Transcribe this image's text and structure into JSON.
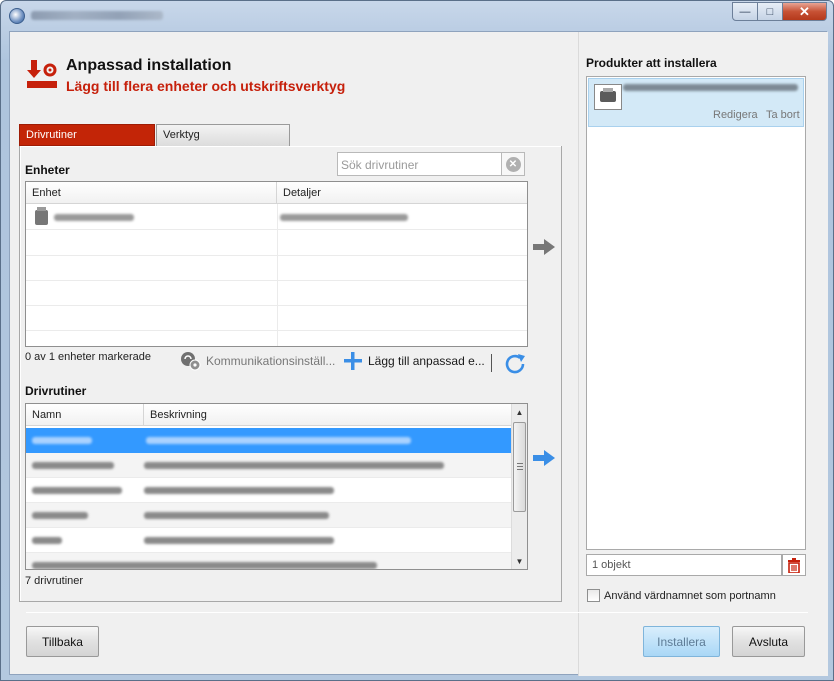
{
  "header": {
    "title": "Anpassad installation",
    "subtitle": "Lägg till flera enheter och utskriftsverktyg"
  },
  "tabs": [
    {
      "label": "Drivrutiner",
      "active": true
    },
    {
      "label": "Verktyg",
      "active": false
    }
  ],
  "devices": {
    "section_label": "Enheter",
    "search_placeholder": "Sök drivrutiner",
    "columns": [
      "Enhet",
      "Detaljer"
    ],
    "status": "0 av 1 enheter markerade",
    "communication_button": "Kommunikationsinställ...",
    "add_custom_button": "Lägg till anpassad e..."
  },
  "drivers": {
    "section_label": "Drivrutiner",
    "columns": [
      "Namn",
      "Beskrivning"
    ],
    "count_text": "7 drivrutiner"
  },
  "products": {
    "title": "Produkter att installera",
    "edit_label": "Redigera",
    "remove_label": "Ta bort",
    "count_text": "1 objekt",
    "hostname_checkbox": "Använd värdnamnet som portnamn"
  },
  "footer": {
    "back_button": "Tillbaka",
    "install_button": "Installera",
    "exit_button": "Avsluta"
  },
  "colors": {
    "accent_red": "#c6200b",
    "selection_blue": "#3399ff",
    "arrow_blue": "#3a8ee6"
  }
}
